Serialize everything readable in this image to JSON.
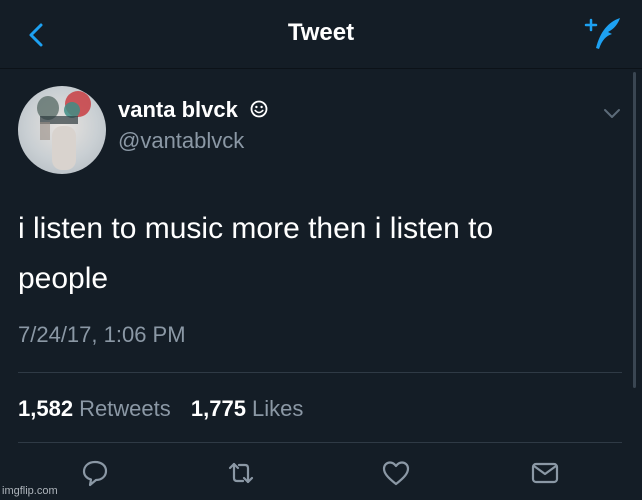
{
  "header": {
    "title": "Tweet"
  },
  "tweet": {
    "display_name": "vanta blvck",
    "handle": "@vantablvck",
    "text": "i listen to music more then i listen to\npeople",
    "timestamp": "7/24/17, 1:06 PM"
  },
  "stats": {
    "retweets_count": "1,582",
    "retweets_label": "Retweets",
    "likes_count": "1,775",
    "likes_label": "Likes"
  },
  "actions": [
    "reply-icon",
    "retweet-icon",
    "like-icon",
    "message-icon"
  ],
  "watermark": "imgflip.com",
  "colors": {
    "background": "#141d26",
    "accent": "#1da1f2",
    "secondary_text": "#8b98a5"
  }
}
